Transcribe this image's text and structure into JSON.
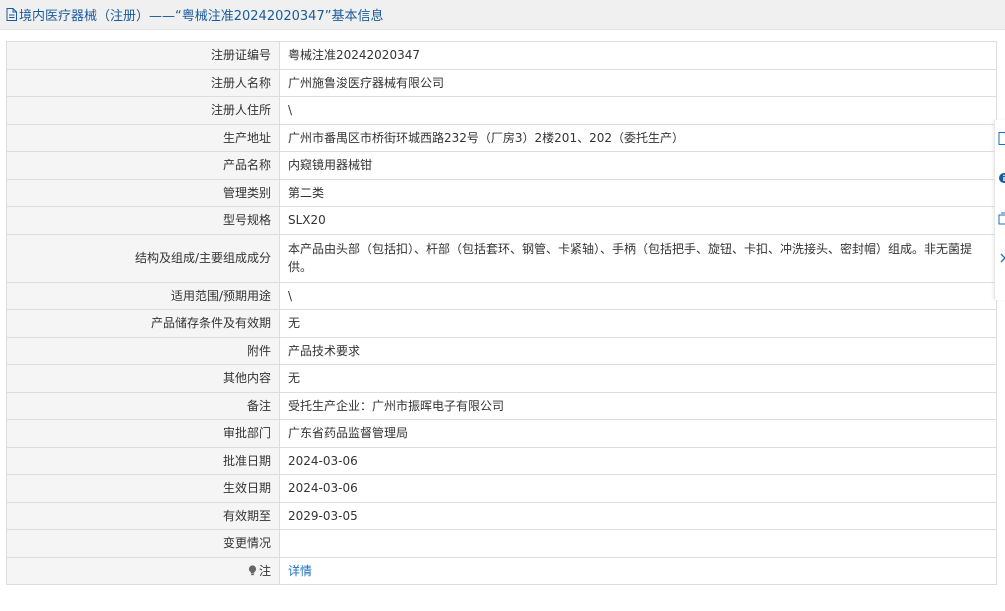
{
  "header": {
    "title": "境内医疗器械（注册）——“粤械注准20242020347”基本信息"
  },
  "rows": [
    {
      "label": "注册证编号",
      "value": "粤械注准20242020347"
    },
    {
      "label": "注册人名称",
      "value": "广州施鲁浚医疗器械有限公司"
    },
    {
      "label": "注册人住所",
      "value": "\\"
    },
    {
      "label": "生产地址",
      "value": "广州市番禺区市桥街环城西路232号（厂房3）2楼201、202（委托生产）"
    },
    {
      "label": "产品名称",
      "value": "内窥镜用器械钳"
    },
    {
      "label": "管理类别",
      "value": "第二类"
    },
    {
      "label": "型号规格",
      "value": "SLX20"
    },
    {
      "label": "结构及组成/主要组成成分",
      "value": "本产品由头部（包括扣）、杆部（包括套环、钢管、卡紧轴）、手柄（包括把手、旋钮、卡扣、冲洗接头、密封帽）组成。非无菌提供。"
    },
    {
      "label": "适用范围/预期用途",
      "value": "\\"
    },
    {
      "label": "产品储存条件及有效期",
      "value": "无"
    },
    {
      "label": "附件",
      "value": "产品技术要求"
    },
    {
      "label": "其他内容",
      "value": "无"
    },
    {
      "label": "备注",
      "value": "受托生产企业：广州市振晖电子有限公司"
    },
    {
      "label": "审批部门",
      "value": "广东省药品监督管理局"
    },
    {
      "label": "批准日期",
      "value": "2024-03-06"
    },
    {
      "label": "生效日期",
      "value": "2024-03-06"
    },
    {
      "label": "有效期至",
      "value": "2029-03-05"
    },
    {
      "label": "变更情况",
      "value": ""
    }
  ],
  "note": {
    "label": "注",
    "link_text": "详情",
    "icon": "lightbulb-icon"
  },
  "icons": {
    "title": "document-icon",
    "side_tools": [
      "document-icon",
      "info-icon",
      "copy-icon",
      "chevron-right-icon"
    ]
  },
  "colors": {
    "title_text": "#1a5b9c",
    "link": "#1a6fc4",
    "label_bg": "#f5f5f5",
    "border": "#dddddd"
  }
}
